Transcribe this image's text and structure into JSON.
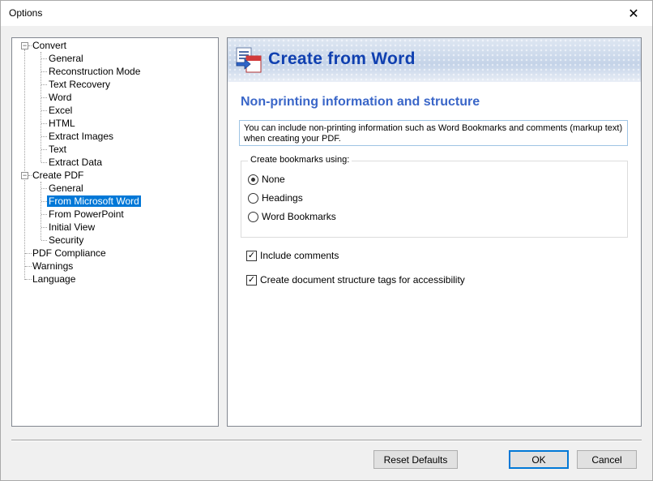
{
  "window": {
    "title": "Options"
  },
  "tree": {
    "convert": {
      "label": "Convert",
      "children": [
        "General",
        "Reconstruction Mode",
        "Text Recovery",
        "Word",
        "Excel",
        "HTML",
        "Extract Images",
        "Text",
        "Extract Data"
      ]
    },
    "create_pdf": {
      "label": "Create PDF",
      "children": [
        "General",
        "From Microsoft Word",
        "From PowerPoint",
        "Initial View",
        "Security"
      ]
    },
    "others": [
      "PDF Compliance",
      "Warnings",
      "Language"
    ],
    "selected": "From Microsoft Word"
  },
  "panel": {
    "banner_title": "Create from Word",
    "section_title": "Non-printing information and structure",
    "info_text": "You can include non-printing information such as Word Bookmarks and comments (markup text) when creating your PDF.",
    "bookmarks_group": {
      "label": "Create bookmarks using:",
      "options": [
        "None",
        "Headings",
        "Word Bookmarks"
      ],
      "selected": "None"
    },
    "checkboxes": [
      {
        "label": "Include comments",
        "checked": true
      },
      {
        "label": "Create document structure tags for accessibility",
        "checked": true
      }
    ]
  },
  "buttons": {
    "reset_defaults": "Reset Defaults",
    "ok": "OK",
    "cancel": "Cancel"
  },
  "icons": {
    "close": "close-icon",
    "banner": "word-to-pdf-icon"
  },
  "colors": {
    "selection": "#0078d7",
    "banner_title": "#1040b0",
    "section_title": "#3a66c8"
  }
}
